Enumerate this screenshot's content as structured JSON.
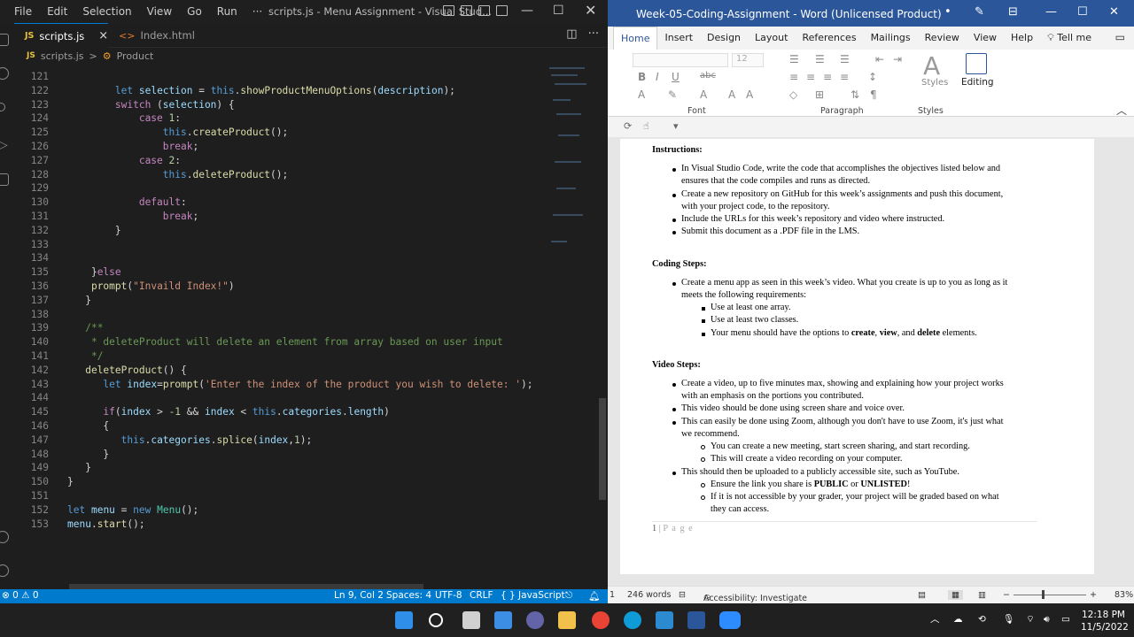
{
  "vscode": {
    "menu": [
      "File",
      "Edit",
      "Selection",
      "View",
      "Go",
      "Run",
      "···"
    ],
    "window_title": "scripts.js - Menu Assignment - Visual Stud...",
    "tabs": [
      {
        "label": "scripts.js",
        "kind": "JS",
        "close": "×"
      },
      {
        "label": "Index.html",
        "kind": "<>"
      }
    ],
    "breadcrumb": {
      "file": "scripts.js",
      "sep": ">",
      "symbol": "Product"
    },
    "code_lines": [
      {
        "n": "121",
        "html": ""
      },
      {
        "n": "122",
        "html": "        <span class='kw'>let</span> <span class='vr'>selection</span> = <span class='kw'>this</span>.<span class='fn'>showProductMenuOptions</span>(<span class='vr'>description</span>);"
      },
      {
        "n": "123",
        "html": "        <span class='kc'>switch</span> (<span class='vr'>selection</span>) {"
      },
      {
        "n": "124",
        "html": "            <span class='kc'>case</span> <span class='nm'>1</span>:"
      },
      {
        "n": "125",
        "html": "                <span class='kw'>this</span>.<span class='fn'>createProduct</span>();"
      },
      {
        "n": "126",
        "html": "                <span class='kc'>break</span>;"
      },
      {
        "n": "127",
        "html": "            <span class='kc'>case</span> <span class='nm'>2</span>:"
      },
      {
        "n": "128",
        "html": "                <span class='kw'>this</span>.<span class='fn'>deleteProduct</span>();"
      },
      {
        "n": "129",
        "html": ""
      },
      {
        "n": "130",
        "html": "            <span class='kc'>default</span>:"
      },
      {
        "n": "131",
        "html": "                <span class='kc'>break</span>;"
      },
      {
        "n": "132",
        "html": "        }"
      },
      {
        "n": "133",
        "html": ""
      },
      {
        "n": "134",
        "html": ""
      },
      {
        "n": "135",
        "html": "    }<span class='kc'>else</span>"
      },
      {
        "n": "136",
        "html": "    <span class='fn'>prompt</span>(<span class='st'>\"Invaild Index!\"</span>)"
      },
      {
        "n": "137",
        "html": "   }"
      },
      {
        "n": "138",
        "html": ""
      },
      {
        "n": "139",
        "html": "   <span class='cm'>/**</span>"
      },
      {
        "n": "140",
        "html": "   <span class='cm'> * deleteProduct will delete an element from array based on user input</span>"
      },
      {
        "n": "141",
        "html": "   <span class='cm'> */</span>"
      },
      {
        "n": "142",
        "html": "   <span class='fn'>deleteProduct</span>() {"
      },
      {
        "n": "143",
        "html": "      <span class='kw'>let</span> <span class='vr'>index</span>=<span class='fn'>prompt</span>(<span class='st'>'Enter the index of the product you wish to delete: '</span>);"
      },
      {
        "n": "144",
        "html": ""
      },
      {
        "n": "145",
        "html": "      <span class='kc'>if</span>(<span class='vr'>index</span> &gt; <span class='nm'>-1</span> &amp;&amp; <span class='vr'>index</span> &lt; <span class='kw'>this</span>.<span class='vr'>categories</span>.<span class='vr'>length</span>)"
      },
      {
        "n": "146",
        "html": "      {"
      },
      {
        "n": "147",
        "html": "         <span class='kw'>this</span>.<span class='vr'>categories</span>.<span class='fn'>splice</span>(<span class='vr'>index</span>,<span class='nm'>1</span>);"
      },
      {
        "n": "148",
        "html": "      }"
      },
      {
        "n": "149",
        "html": "   }"
      },
      {
        "n": "150",
        "html": "}"
      },
      {
        "n": "151",
        "html": ""
      },
      {
        "n": "152",
        "html": "<span class='kw'>let</span> <span class='vr'>menu</span> = <span class='kw'>new</span> <span class='cl'>Menu</span>();"
      },
      {
        "n": "153",
        "html": "<span class='vr'>menu</span>.<span class='fn'>start</span>();"
      }
    ],
    "status": {
      "errors": "⊗ 0 ⚠ 0",
      "position": "Ln 9, Col 2",
      "spaces": "Spaces: 4",
      "encoding": "UTF-8",
      "eol": "CRLF",
      "language": "{ } JavaScript"
    }
  },
  "word": {
    "window_title": "Week-05-Coding-Assignment  -  Word (Unlicensed Product)",
    "tabs": [
      "Home",
      "Insert",
      "Design",
      "Layout",
      "References",
      "Mailings",
      "Review",
      "View",
      "Help",
      "Tell me"
    ],
    "font_size": "12",
    "groups": {
      "font": "Font",
      "paragraph": "Paragraph",
      "styles": "Styles",
      "editing": "Editing",
      "styles_btn": "Styles"
    },
    "doc": {
      "instructions_heading": "Instructions:",
      "instructions": [
        "In Visual Studio Code, write the code that accomplishes the objectives listed below and",
        "ensures that the code compiles and runs as directed.",
        "Create a new repository on GitHub for this week’s assignments and push this document,",
        "with your project code, to the repository.",
        "Include the URLs for this week’s repository and video where instructed.",
        "Submit this document as a .PDF file in the LMS."
      ],
      "coding_heading": "Coding Steps:",
      "coding_1a": "Create a menu app as seen in this week’s video. What you create is up to you as long as it",
      "coding_1b": "meets the following requirements:",
      "coding_sub": [
        "Use at least one array.",
        "Use at least two classes."
      ],
      "coding_sub3_pre": "Your menu should have the options to ",
      "coding_sub3_b1": "create",
      "coding_sub3_c1": ", ",
      "coding_sub3_b2": "view",
      "coding_sub3_c2": ", and ",
      "coding_sub3_b3": "delete",
      "coding_sub3_post": " elements.",
      "video_heading": "Video Steps:",
      "video": [
        "Create a video, up to five minutes max, showing and explaining how your project works",
        "with an emphasis on the portions you contributed.",
        "This video should be done using screen share and voice over.",
        "This can easily be done using Zoom, although you don't have to use Zoom, it's just what",
        "we recommend.",
        "You can create a new meeting, start screen sharing, and start recording.",
        "This will create a video recording on your computer.",
        "This should then be uploaded to a publicly accessible site, such as YouTube.",
        "Ensure the link you share is ",
        "PUBLIC",
        " or ",
        "UNLISTED",
        "!",
        "If it is not accessible by your grader, your project will be graded based on what",
        "they can access."
      ],
      "page_footer_num": "1",
      "page_footer_sep": " | ",
      "page_footer_txt": "P a g e"
    },
    "status": {
      "page": "1",
      "words": "246 words",
      "accessibility": "Accessibility: Investigate",
      "zoom": "83%"
    }
  },
  "taskbar": {
    "time": "12:18 PM",
    "date": "11/5/2022"
  }
}
